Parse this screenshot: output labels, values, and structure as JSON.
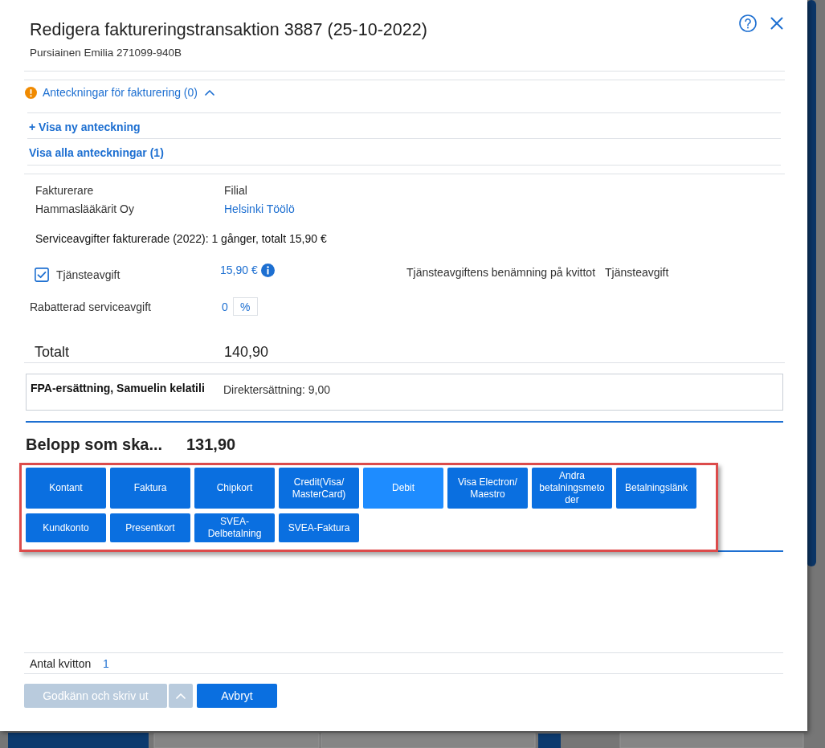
{
  "dialog": {
    "title": "Redigera faktureringstransaktion 3887 (25-10-2022)",
    "subtitle": "Pursiainen Emilia 271099-940B"
  },
  "notes": {
    "heading": "Anteckningar för fakturering (0)",
    "expanded": true,
    "links": [
      {
        "label": "+ Visa ny anteckning"
      },
      {
        "label": "Visa alla anteckningar (1)"
      }
    ]
  },
  "billing": {
    "columns": [
      {
        "label": "Fakturerare",
        "value": "Hammaslääkärit Oy",
        "kind": "text"
      },
      {
        "label": "Filial",
        "value": "Helsinki Töölö",
        "kind": "link"
      }
    ]
  },
  "service_fee_summary": "Serviceavgifter fakturerade (2022): 1 gånger, totalt 15,90 €",
  "service_fee": {
    "label": "Tjänsteavgift",
    "checked": true,
    "amount": "15,90 €",
    "receipt_label": "Tjänsteavgiftens benämning på kvittot",
    "receipt_value": "Tjänsteavgift"
  },
  "discount": {
    "label": "Rabatterad serviceavgift",
    "value": "0",
    "unit": "%"
  },
  "total": {
    "label": "Totalt",
    "value": "140,90"
  },
  "reimbursement": {
    "name": "FPA-ersättning, Samuelin kelatili",
    "detail": "Direktersättning: 9,00"
  },
  "amount_due": {
    "label": "Belopp som ska...",
    "value": "131,90"
  },
  "payment_panel": {
    "highlighted": true,
    "methods": [
      {
        "label": "Kontant",
        "selected": false
      },
      {
        "label": "Faktura",
        "selected": false
      },
      {
        "label": "Chipkort",
        "selected": false
      },
      {
        "label": "Credit(Visa/MasterCard)",
        "selected": false
      },
      {
        "label": "Debit",
        "selected": true
      },
      {
        "label": "Visa Electron/Maestro",
        "selected": false
      },
      {
        "label": "Andra betalningsmetoder",
        "selected": false
      },
      {
        "label": "Betalningslänk",
        "selected": false
      },
      {
        "label": "Kundkonto",
        "selected": false
      },
      {
        "label": "Presentkort",
        "selected": false
      },
      {
        "label": "SVEA-Delbetalning",
        "selected": false
      },
      {
        "label": "SVEA-Faktura",
        "selected": false
      }
    ]
  },
  "footer": {
    "receipts_label": "Antal kvitton",
    "receipts_value": "1",
    "buttons": [
      {
        "label": "Godkänn och skriv ut",
        "kind": "split",
        "disabled": true
      },
      {
        "label": "Avbryt",
        "kind": "plain",
        "disabled": false
      }
    ]
  }
}
